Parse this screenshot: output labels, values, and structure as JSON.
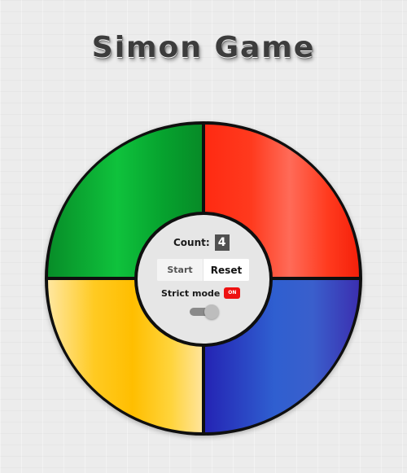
{
  "header": {
    "title": "Simon Game"
  },
  "controls": {
    "count_label": "Count:",
    "count_value": "4",
    "start_label": "Start",
    "reset_label": "Reset",
    "strict_label": "Strict mode",
    "strict_indicator": "ON",
    "strict_toggle_state": "on"
  },
  "pads": {
    "green": "#0fc23c",
    "red": "#ff3a1e",
    "yellow": "#ffbe00",
    "blue": "#2f5fd0"
  }
}
